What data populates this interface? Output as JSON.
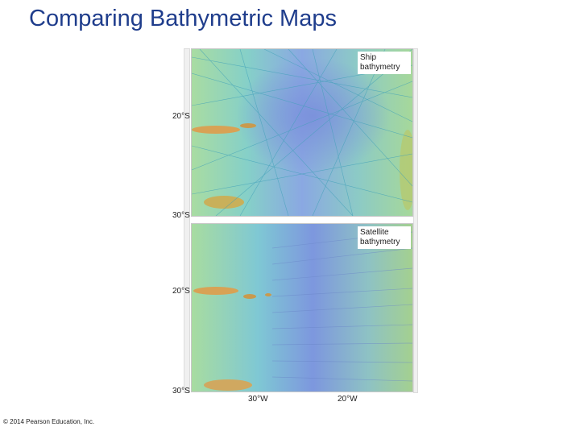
{
  "slide": {
    "title": "Comparing Bathymetric Maps",
    "copyright": "© 2014 Pearson Education, Inc."
  },
  "ship_map": {
    "label_line1": "Ship",
    "label_line2": "bathymetry",
    "lat_top": "20°S",
    "lat_bottom": "30°S"
  },
  "satellite_map": {
    "label_line1": "Satellite",
    "label_line2": "bathymetry",
    "lat_top": "20°S",
    "lat_bottom": "30°S",
    "lon_left": "30°W",
    "lon_right": "20°W"
  },
  "colors": {
    "title": "#1f3d8c",
    "deep_water": "#7d97de",
    "mid_water": "#77c4d2",
    "shallow_water": "#a9dca2",
    "land": "#d8a255",
    "ship_tracks": "#3fa0b8"
  }
}
